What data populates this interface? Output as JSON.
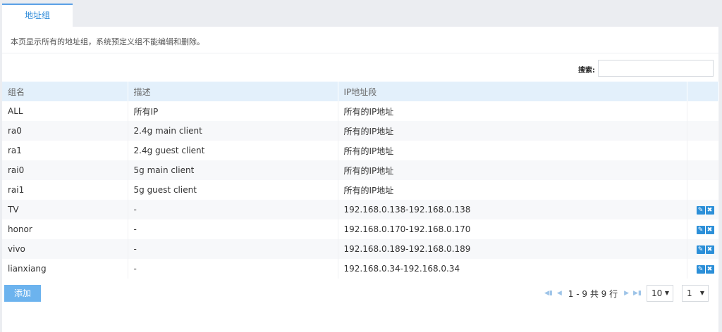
{
  "tab": {
    "label": "地址组"
  },
  "description": "本页显示所有的地址组，系统预定义组不能编辑和删除。",
  "search": {
    "label": "搜索:",
    "value": ""
  },
  "table": {
    "headers": [
      "组名",
      "描述",
      "IP地址段",
      ""
    ],
    "rows": [
      {
        "name": "ALL",
        "desc": "所有IP",
        "ip": "所有的IP地址",
        "editable": false
      },
      {
        "name": "ra0",
        "desc": "2.4g main client",
        "ip": "所有的IP地址",
        "editable": false
      },
      {
        "name": "ra1",
        "desc": "2.4g guest client",
        "ip": "所有的IP地址",
        "editable": false
      },
      {
        "name": "rai0",
        "desc": "5g main client",
        "ip": "所有的IP地址",
        "editable": false
      },
      {
        "name": "rai1",
        "desc": "5g guest client",
        "ip": "所有的IP地址",
        "editable": false
      },
      {
        "name": "TV",
        "desc": "-",
        "ip": "192.168.0.138-192.168.0.138",
        "editable": true
      },
      {
        "name": "honor",
        "desc": "-",
        "ip": "192.168.0.170-192.168.0.170",
        "editable": true
      },
      {
        "name": "vivo",
        "desc": "-",
        "ip": "192.168.0.189-192.168.0.189",
        "editable": true
      },
      {
        "name": "lianxiang",
        "desc": "-",
        "ip": "192.168.0.34-192.168.0.34",
        "editable": true
      }
    ]
  },
  "pager": {
    "summary": "1 - 9 共 9 行",
    "page_size": "10",
    "page": "1"
  },
  "icons": {
    "edit": "pencil-icon",
    "delete": "close-icon",
    "first": "first-page-icon",
    "prev": "prev-page-icon",
    "next": "next-page-icon",
    "last": "last-page-icon"
  },
  "colors": {
    "accent": "#2c8fd8",
    "header_bg": "#e3f0fb",
    "add_button": "#6cb3ee"
  },
  "actions": {
    "add_label": "添加"
  }
}
